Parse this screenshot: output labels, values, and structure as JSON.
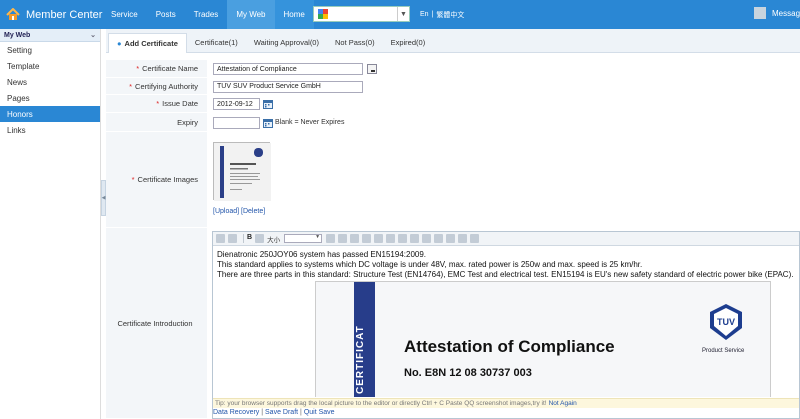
{
  "app": {
    "title": "Member Center"
  },
  "nav": {
    "items": [
      "Service",
      "Posts",
      "Trades",
      "My Web",
      "Home"
    ]
  },
  "lang": {
    "en": "En",
    "zh": "繁體中文"
  },
  "user": {
    "label": "Messag"
  },
  "sidebar": {
    "header": "My Web",
    "items": [
      "Setting",
      "Template",
      "News",
      "Pages",
      "Honors",
      "Links"
    ]
  },
  "tabs": [
    "Add Certificate",
    "Certificate(1)",
    "Waiting Approval(0)",
    "Not Pass(0)",
    "Expired(0)"
  ],
  "form": {
    "name_label": "Certificate Name",
    "name_value": "Attestation of Compliance",
    "authority_label": "Certifying Authority",
    "authority_value": "TUV SUV Product Service GmbH",
    "issue_label": "Issue Date",
    "issue_value": "2012-09-12",
    "expiry_label": "Expiry",
    "expiry_value": "",
    "expiry_hint": "Blank = Never Expires",
    "images_label": "Certificate Images",
    "upload_label": "[Upload]",
    "delete_label": "[Delete]",
    "intro_label": "Certificate Introduction",
    "editor_font_size": "大小"
  },
  "editor": {
    "line1": "Dienatronic 250JOY06 system has passed EN15194:2009.",
    "line2": "This standard applies to systems which DC voltage is under 48V, max. rated power is 250w and max. speed is 25 km/hr.",
    "line3": " There are three parts in this standard: Structure Test (EN14764), EMC Test and electrical test. EN15194 is EU's new safety standard of electric power bike (EPAC).",
    "cert_word": "CERTIFICAT",
    "cert_title": "Attestation of Compliance",
    "cert_no": "No.   E8N 12 08 30737 003",
    "tuv_logo": "TUV",
    "tuv_sub": "Product Service"
  },
  "tip": {
    "text": "Tip: your browser supports drag the local picture to the editor or directly Ctrl + C Paste QQ screenshot images,try it!",
    "not_again": "Not Again"
  },
  "footer": {
    "data_recovery": "Data Recovery",
    "save_draft": "Save Draft",
    "quit_save": "Quit Save"
  },
  "colors": {
    "brand": "#2a87d4",
    "required": "#dd2222",
    "link": "#2255aa"
  }
}
